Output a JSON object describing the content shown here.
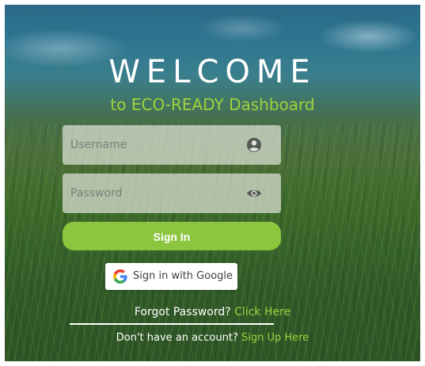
{
  "header": {
    "title": "WELCOME",
    "subtitle": "to ECO-READY Dashboard"
  },
  "form": {
    "username_placeholder": "Username",
    "password_placeholder": "Password",
    "username_icon": "user-circle-icon",
    "password_icon": "eye-icon",
    "signin_label": "Sign In",
    "google_label": "Sign in with Google",
    "google_icon": "google-g-icon"
  },
  "footer": {
    "forgot_text": "Forgot Password?",
    "forgot_link": "Click Here",
    "signup_text": "Don't have an account?",
    "signup_link": "Sign Up Here"
  },
  "colors": {
    "accent": "#8cc63f",
    "link": "#9fd23c",
    "text": "#ffffff"
  }
}
